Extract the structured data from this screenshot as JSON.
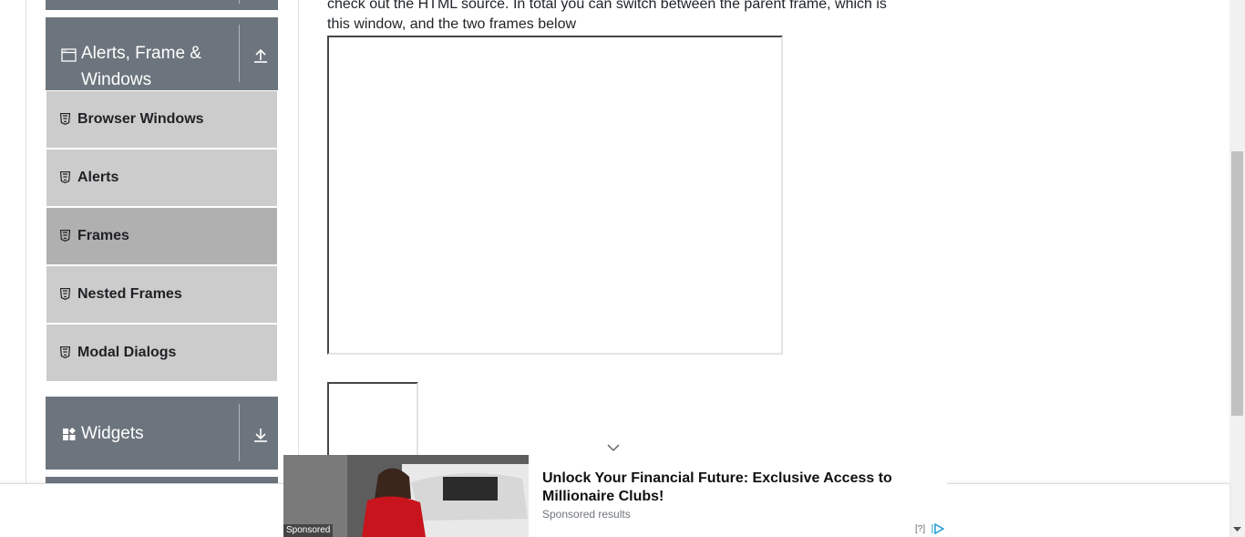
{
  "content": {
    "intro_text": "check out the HTML source. In total you can switch between the parent frame, which is this window, and the two frames below"
  },
  "sidebar": {
    "groups": [
      {
        "title": "Alerts, Frame & Windows",
        "icon": "window-icon",
        "toggle_icon": "arrow-up-icon"
      },
      {
        "title": "Widgets",
        "icon": "widgets-icon",
        "toggle_icon": "arrow-down-icon"
      }
    ],
    "items": [
      {
        "label": "Browser Windows",
        "icon": "html5-icon",
        "active": false
      },
      {
        "label": "Alerts",
        "icon": "html5-icon",
        "active": false
      },
      {
        "label": "Frames",
        "icon": "html5-icon",
        "active": true
      },
      {
        "label": "Nested Frames",
        "icon": "html5-icon",
        "active": false
      },
      {
        "label": "Modal Dialogs",
        "icon": "html5-icon",
        "active": false
      }
    ]
  },
  "ad": {
    "badge": "Sponsored",
    "title": "Unlock Your Financial Future: Exclusive Access to Millionaire Clubs!",
    "subtitle": "Sponsored results",
    "info": "[?]",
    "choice_icon": "adchoices-icon",
    "collapse_icon": "chevron-down-icon"
  },
  "colors": {
    "group_bg": "#6c757d",
    "item_bg": "#cccccc",
    "item_active_bg": "#b0b0b0"
  }
}
